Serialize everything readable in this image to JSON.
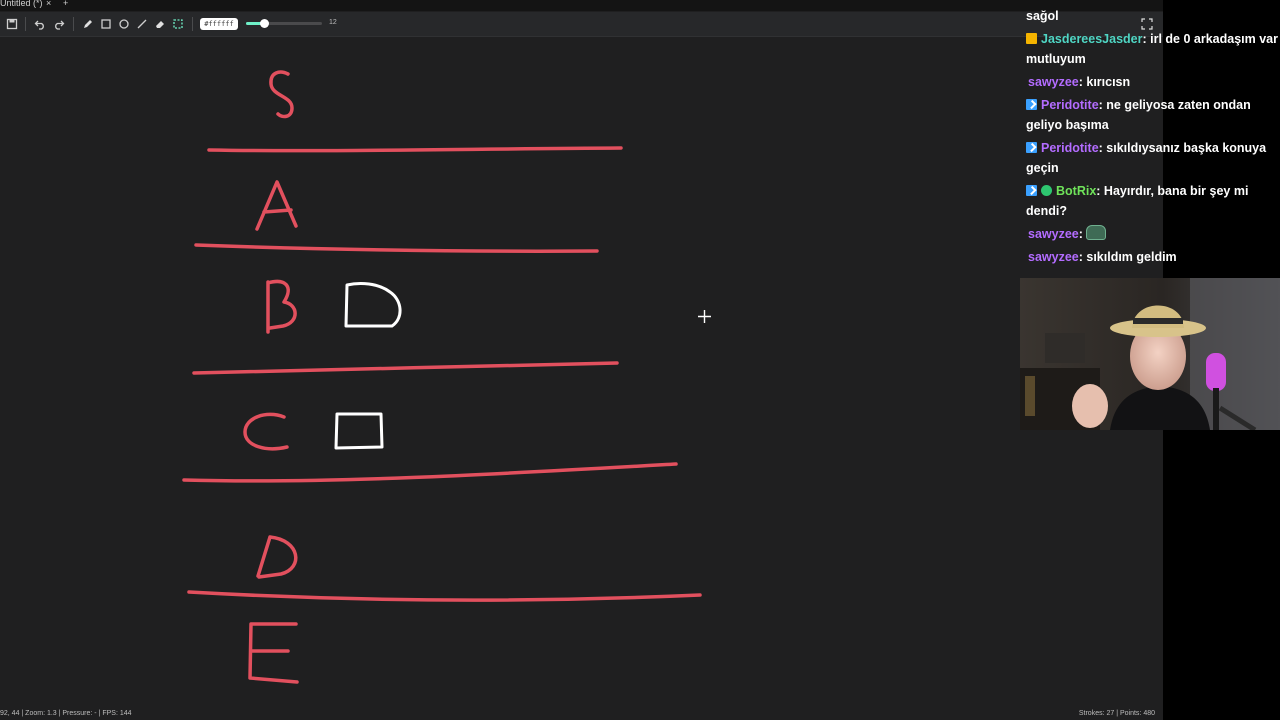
{
  "tab": {
    "title": "Untitled (*)",
    "close": "×",
    "new": "+"
  },
  "toolbar": {
    "icons": [
      "save-icon",
      "undo-icon",
      "redo-icon",
      "pen-icon",
      "rectangle-icon",
      "circle-icon",
      "line-icon",
      "eraser-icon",
      "select-icon"
    ],
    "color_value": "#ffffff",
    "size_value": "12",
    "size_fraction": 0.24,
    "accent": "#6ff0c8"
  },
  "canvas": {
    "stroke_color": "#e2505e",
    "white_stroke": "#ffffff",
    "letters": [
      "S",
      "A",
      "B",
      "C",
      "D",
      "E"
    ]
  },
  "status": {
    "left": "92, 44 | Zoom: 1.3 | Pressure: - | FPS: 144",
    "right": "Strokes: 27 | Points: 480"
  },
  "chat": {
    "messages": [
      {
        "badges": [],
        "user": "",
        "color": "#ffffff",
        "text": "sağol"
      },
      {
        "badges": [
          "crown"
        ],
        "user": "JasdereesJasder",
        "color": "#4fd6c4",
        "text": ": irl de 0 arkadaşım var mutluyum"
      },
      {
        "badges": [],
        "user": "sawyzee",
        "color": "#b36cff",
        "text": ": kırıcısn"
      },
      {
        "badges": [
          "prime"
        ],
        "user": "Peridotite",
        "color": "#b36cff",
        "text": ": ne geliyosa zaten ondan geliyo başıma"
      },
      {
        "badges": [
          "prime"
        ],
        "user": "Peridotite",
        "color": "#b36cff",
        "text": ": sıkıldıysanız başka konuya geçin"
      },
      {
        "badges": [
          "prime",
          "verified"
        ],
        "user": "BotRix",
        "color": "#6fe35a",
        "text": ": Hayırdır, bana bir şey mi dendi?"
      },
      {
        "badges": [],
        "user": "sawyzee",
        "color": "#b36cff",
        "text": ": ",
        "emote": "emote-icon"
      },
      {
        "badges": [],
        "user": "sawyzee",
        "color": "#b36cff",
        "text": ": sıkıldım geldim"
      }
    ]
  }
}
